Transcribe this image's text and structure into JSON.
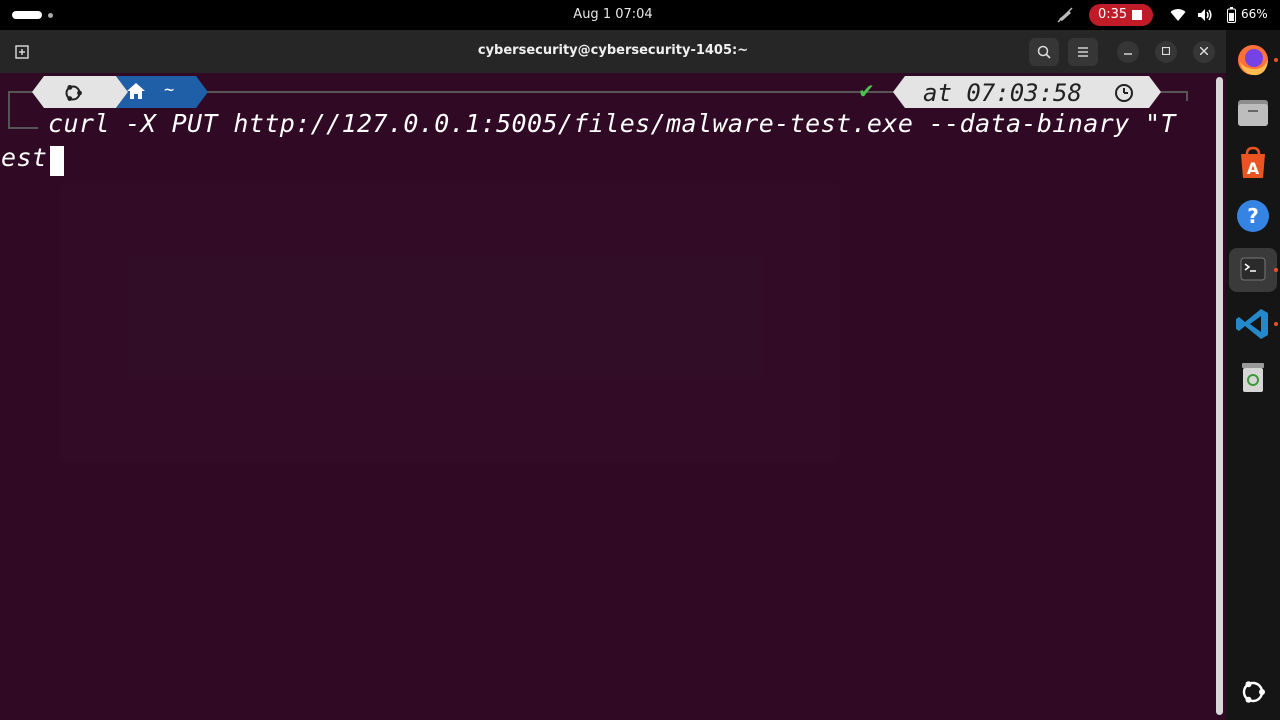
{
  "topbar": {
    "clock": "Aug 1  07:04",
    "recording_time": "0:35",
    "battery_percent": "66%"
  },
  "window": {
    "title": "cybersecurity@cybersecurity-1405:~"
  },
  "prompt": {
    "directory": "~",
    "time": "at 07:03:58",
    "status": "✔"
  },
  "terminal": {
    "command_line_1": "curl -X PUT http://127.0.0.1:5005/files/malware-test.exe --data-binary \"T",
    "command_line_2": "est"
  },
  "icons": {
    "activities": "activities-indicator",
    "new_tab": "new-tab-icon",
    "search": "search-icon",
    "menu": "hamburger-menu-icon",
    "minimize": "minimize-icon",
    "maximize": "maximize-icon",
    "close": "close-icon",
    "ubuntu": "ubuntu-logo-icon",
    "home": "home-icon",
    "clock": "clock-icon",
    "wifi": "wifi-icon",
    "volume": "volume-icon",
    "battery": "battery-icon",
    "screen_share": "screen-share-off-icon"
  },
  "dock": {
    "apps": [
      "firefox",
      "files",
      "app-center",
      "help",
      "terminal",
      "vscode",
      "trash",
      "show-apps"
    ]
  },
  "colors": {
    "terminal_bg": "#300a24",
    "headerbar_bg": "#262626",
    "record_pill": "#c01c28",
    "prompt_dir_segment": "#1f5fa8",
    "prompt_light_segment": "#e4e4e4",
    "status_ok": "#4ec24e",
    "ubuntu_orange": "#e95420"
  }
}
